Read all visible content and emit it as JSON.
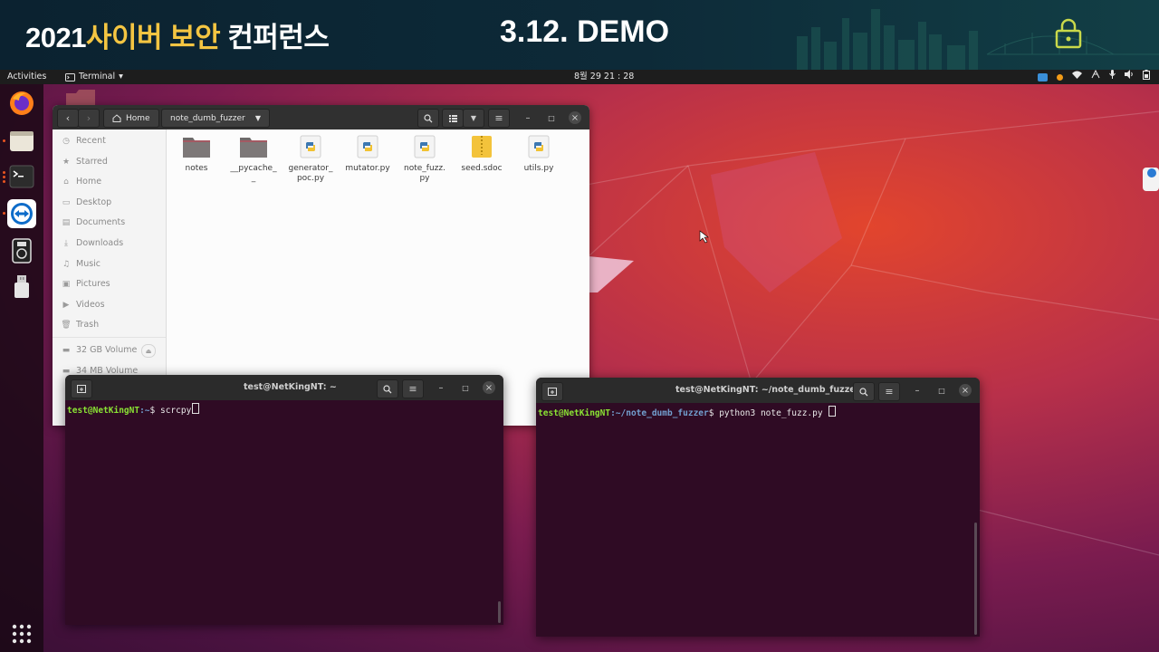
{
  "banner": {
    "year": "2021",
    "highlight": "사이버 보안",
    "suffix": "컨퍼런스",
    "demo": "3.12. DEMO"
  },
  "topbar": {
    "activities": "Activities",
    "app_menu": "Terminal",
    "clock": "8월 29  21 : 28"
  },
  "dock": {
    "items": [
      "firefox-icon",
      "files-icon",
      "terminal-icon",
      "teamviewer-icon",
      "media-player-icon",
      "usb-drive-icon"
    ],
    "show_apps": "show-applications-icon"
  },
  "files_window": {
    "breadcrumb_home": "Home",
    "breadcrumb_current": "note_dumb_fuzzer",
    "sidebar": [
      "Recent",
      "Starred",
      "Home",
      "Desktop",
      "Documents",
      "Downloads",
      "Music",
      "Pictures",
      "Videos",
      "Trash"
    ],
    "volumes": [
      "32 GB Volume",
      "34 MB Volume"
    ],
    "files": [
      {
        "name": "notes",
        "type": "folder"
      },
      {
        "name": "__pycache_\n_",
        "type": "folder"
      },
      {
        "name": "generator_\npoc.py",
        "type": "python"
      },
      {
        "name": "mutator.py",
        "type": "python"
      },
      {
        "name": "note_fuzz.\npy",
        "type": "python"
      },
      {
        "name": "seed.sdoc",
        "type": "archive"
      },
      {
        "name": "utils.py",
        "type": "python"
      }
    ]
  },
  "terminal_left": {
    "title": "test@NetKingNT: ~",
    "prompt_user": "test@NetKingNT",
    "prompt_path": ":~",
    "prompt_symbol": "$ ",
    "command": "scrcpy"
  },
  "terminal_right": {
    "title": "test@NetKingNT: ~/note_dumb_fuzzer",
    "prompt_user": "test@NetKingNT",
    "prompt_path": ":~/note_dumb_fuzzer",
    "prompt_symbol": "$ ",
    "command": "python3 note_fuzz.py "
  },
  "colors": {
    "ubuntu_orange": "#e95420",
    "terminal_bg": "#300a24",
    "prompt_green": "#8ae234",
    "prompt_blue": "#729fcf",
    "banner_highlight": "#f4c542"
  }
}
